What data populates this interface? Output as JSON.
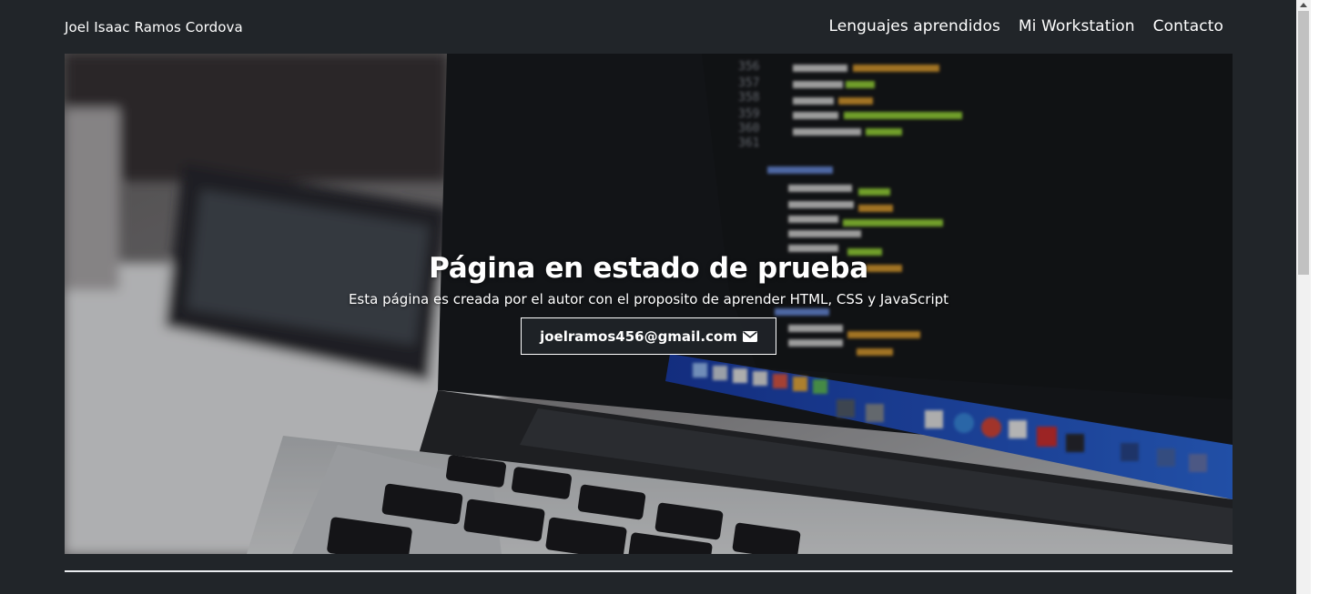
{
  "navbar": {
    "brand": "Joel Isaac Ramos Cordova",
    "links": [
      {
        "label": "Lenguajes aprendidos"
      },
      {
        "label": "Mi Workstation"
      },
      {
        "label": "Contacto"
      }
    ]
  },
  "hero": {
    "title": "Página en estado de prueba",
    "subtitle": "Esta página es creada por el autor con el proposito de aprender HTML, CSS y JavaScript",
    "email_button": {
      "label": "joelramos456@gmail.com",
      "icon": "envelope-icon"
    },
    "background_image": "laptop-with-code"
  },
  "colors": {
    "page_bg": "#212529",
    "text": "#ffffff",
    "divider": "#e9ecef"
  }
}
